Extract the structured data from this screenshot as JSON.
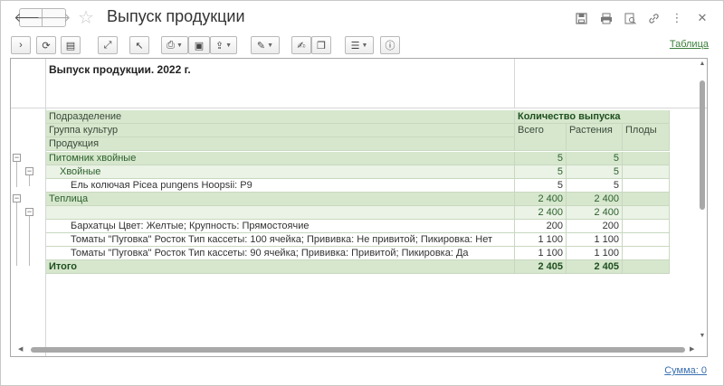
{
  "window": {
    "title": "Выпуск продукции",
    "icons": [
      "save-icon",
      "print-icon",
      "preview-icon",
      "link-icon",
      "more-icon",
      "close-icon"
    ]
  },
  "toolbar": {
    "table_link": "Таблица"
  },
  "report": {
    "title": "Выпуск продукции. 2022 г.",
    "headers": {
      "subdivision": "Подразделение",
      "crop_group": "Группа культур",
      "product": "Продукция",
      "quantity": "Количество выпуска",
      "total": "Всего",
      "plants": "Растения",
      "fruits": "Плоды"
    },
    "rows": [
      {
        "label": "Питомник хвойные",
        "total": "5",
        "plants": "5",
        "fruits": "",
        "kind": "grp",
        "indent": 0
      },
      {
        "label": "Хвойные",
        "total": "5",
        "plants": "5",
        "fruits": "",
        "kind": "sub",
        "indent": 1
      },
      {
        "label": "Ель колючая Picea pungens Hoopsii: P9",
        "total": "5",
        "plants": "5",
        "fruits": "",
        "kind": "plain",
        "indent": 2
      },
      {
        "label": "Теплица",
        "total": "2 400",
        "plants": "2 400",
        "fruits": "",
        "kind": "grp",
        "indent": 0
      },
      {
        "label": "",
        "total": "2 400",
        "plants": "2 400",
        "fruits": "",
        "kind": "sub",
        "indent": 1
      },
      {
        "label": "Бархатцы Цвет: Желтые; Крупность: Прямостоячие",
        "total": "200",
        "plants": "200",
        "fruits": "",
        "kind": "plain",
        "indent": 2
      },
      {
        "label": "Томаты \"Пуговка\" Росток Тип кассеты: 100 ячейка; Прививка: Не привитой; Пикировка: Нет",
        "total": "1 100",
        "plants": "1 100",
        "fruits": "",
        "kind": "plain",
        "indent": 2
      },
      {
        "label": "Томаты \"Пуговка\" Росток Тип кассеты: 90 ячейка; Прививка: Привитой; Пикировка: Да",
        "total": "1 100",
        "plants": "1 100",
        "fruits": "",
        "kind": "plain",
        "indent": 2
      }
    ],
    "grand_total": {
      "label": "Итого",
      "total": "2 405",
      "plants": "2 405",
      "fruits": ""
    }
  },
  "footer": {
    "sum": "Сумма: 0"
  }
}
